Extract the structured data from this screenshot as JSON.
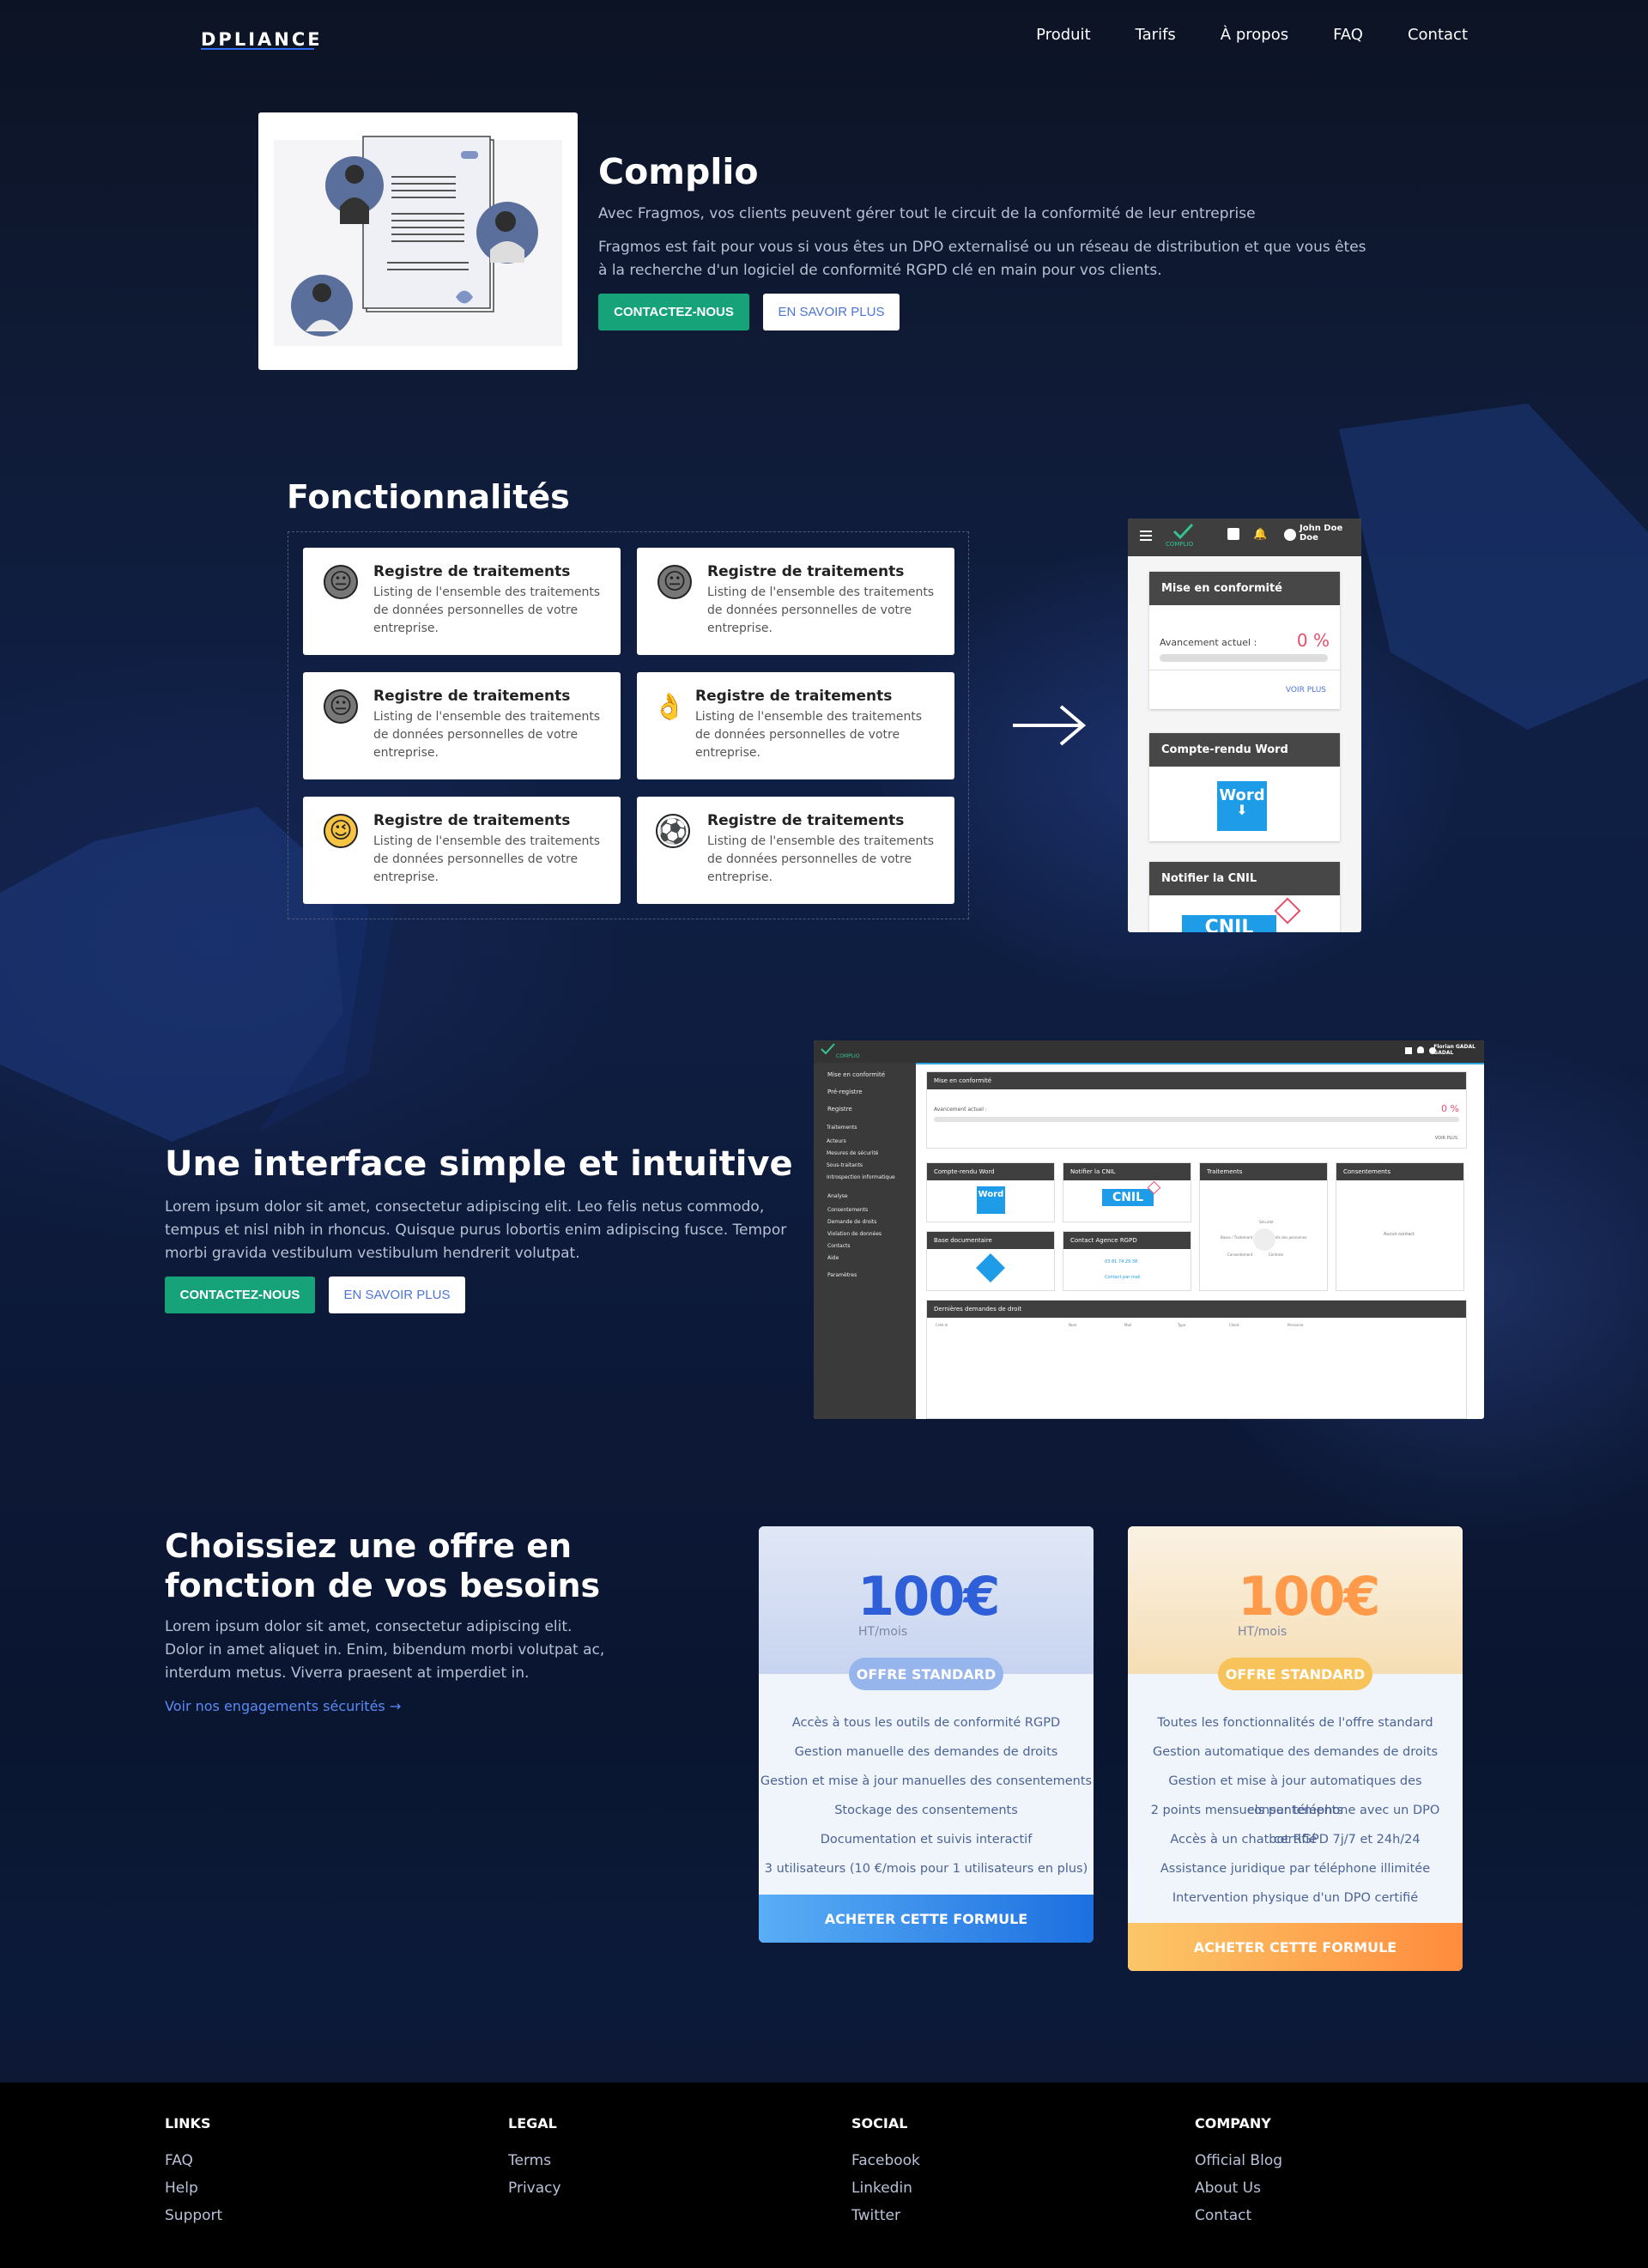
{
  "nav": {
    "logo": "DPLIANCE",
    "links": [
      "Produit",
      "Tarifs",
      "À propos",
      "FAQ",
      "Contact"
    ]
  },
  "hero": {
    "title": "Complio",
    "lead": "Avec Fragmos, vos clients peuvent gérer tout le circuit de la conformité de leur entreprise",
    "body": "Fragmos est fait pour vous si vous êtes un DPO externalisé ou un réseau de distribution et que vous êtes à la recherche d'un logiciel de conformité RGPD clé en main pour vos clients.",
    "btn_contact": "CONTACTEZ-NOUS",
    "btn_more": "EN SAVOIR PLUS"
  },
  "features": {
    "title": "Fonctionnalités",
    "cards": [
      {
        "emoji": "😐",
        "title": "Registre de traitements",
        "desc": "Listing de l'ensemble des traitements de données personnelles de votre entreprise."
      },
      {
        "emoji": "😐",
        "title": "Registre de traitements",
        "desc": "Listing de l'ensemble des traitements de données personnelles de votre entreprise."
      },
      {
        "emoji": "😐",
        "title": "Registre de traitements",
        "desc": "Listing de l'ensemble des traitements de données personnelles de votre entreprise."
      },
      {
        "emoji": "👌",
        "title": "Registre de traitements",
        "desc": "Listing de l'ensemble des traitements de données personnelles de votre entreprise."
      },
      {
        "emoji": "😉",
        "title": "Registre de traitements",
        "desc": "Listing de l'ensemble des traitements de données personnelles de votre entreprise."
      },
      {
        "emoji": "⚽",
        "title": "Registre de traitements",
        "desc": "Listing de l'ensemble des traitements de données personnelles de votre entreprise."
      }
    ]
  },
  "phone": {
    "brand": "COMPLIO",
    "user": "John Doe",
    "user2": "Doe",
    "card1_title": "Mise en conformité",
    "progress_label": "Avancement actuel :",
    "progress_value": "0 %",
    "see_more": "VOIR PLUS",
    "card2_title": "Compte-rendu Word",
    "word_label": "Word",
    "card3_title": "Notifier la CNIL",
    "cnil_label": "CNIL"
  },
  "interface": {
    "title": "Une interface simple et intuitive",
    "body": "Lorem ipsum dolor sit amet, consectetur adipiscing elit. Leo felis netus commodo, tempus et nisl nibh in rhoncus. Quisque purus lobortis enim adipiscing fusce. Tempor morbi gravida vestibulum vestibulum hendrerit volutpat.",
    "btn_contact": "CONTACTEZ-NOUS",
    "btn_more": "EN SAVOIR PLUS"
  },
  "dashboard": {
    "brand": "COMPLIO",
    "user": "Florian GADAL",
    "user2": "GADAL",
    "sidebar": [
      "Mise en conformité",
      "Pré-registre",
      "Registre",
      "Traitements",
      "Acteurs",
      "Mesures de sécurité",
      "Sous-traitants",
      "Introspection informatique",
      "Analyse",
      "Consentements",
      "Demande de droits",
      "Violation de données",
      "Contacts",
      "Aide",
      "Paramètres"
    ],
    "main_title": "Mise en conformité",
    "progress_label": "Avancement actuel :",
    "progress_value": "0 %",
    "see_more": "VOIR PLUS",
    "cards": [
      "Compte-rendu Word",
      "Notifier la CNIL",
      "Traitements",
      "Consentements",
      "Base documentaire",
      "Contact Agence RGPD"
    ],
    "word_label": "Word",
    "cnil_label": "CNIL",
    "phone_number": "03 81 74 29 38",
    "contact_mail": "Contact par mail",
    "no_consent": "Aucun contact",
    "radar_labels": [
      "Sécurité",
      "Bases / Traitement",
      "Droits des personnes",
      "Consentement",
      "Contrats"
    ],
    "table_title": "Dernières demandes de droit",
    "table_cols": [
      "Créé le",
      "Nom",
      "Mail",
      "Type",
      "Client",
      "Personne"
    ]
  },
  "pricing": {
    "title": "Choissiez une offre en fonction de vos besoins",
    "body": "Lorem ipsum dolor sit amet, consectetur adipiscing elit. Dolor in amet aliquet in. Enim, bibendum morbi volutpat ac, interdum metus. Viverra praesent at imperdiet in.",
    "link": "Voir nos engagements sécurités →",
    "plans": [
      {
        "price": "100€",
        "unit": "HT/mois",
        "badge": "OFFRE STANDARD",
        "features": [
          "Accès à tous les outils de conformité RGPD",
          "Gestion manuelle des demandes de droits",
          "Gestion et mise à jour manuelles des consentements",
          "Stockage des consentements",
          "Documentation et suivis interactif",
          "3 utilisateurs (10 €/mois pour 1 utilisateurs en plus)"
        ],
        "cta": "ACHETER CETTE FORMULE",
        "accent": "#2f5fd8"
      },
      {
        "price": "100€",
        "unit": "HT/mois",
        "badge": "OFFRE STANDARD",
        "features": [
          "Toutes les fonctionnalités de l'offre standard",
          "Gestion automatique des demandes de droits",
          "Gestion et mise à jour automatiques des consentements",
          "2 points mensuels par téléphone avec un DPO certifié",
          "Accès à un chatbot RGPD 7j/7 et 24h/24",
          "Assistance juridique par téléphone illimitée",
          "Intervention physique d'un DPO certifié"
        ],
        "cta": "ACHETER CETTE FORMULE",
        "accent": "#ff9a4a"
      }
    ]
  },
  "footer": {
    "cols": [
      {
        "title": "LINKS",
        "items": [
          "FAQ",
          "Help",
          "Support"
        ]
      },
      {
        "title": "LEGAL",
        "items": [
          "Terms",
          "Privacy"
        ]
      },
      {
        "title": "SOCIAL",
        "items": [
          "Facebook",
          "Linkedin",
          "Twitter"
        ]
      },
      {
        "title": "COMPANY",
        "items": [
          "Official Blog",
          "About Us",
          "Contact"
        ]
      }
    ]
  }
}
